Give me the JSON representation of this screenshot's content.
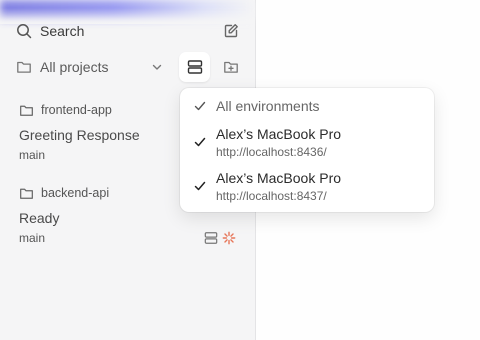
{
  "sidebar": {
    "search": {
      "label": "Search",
      "icon": "search-icon"
    },
    "new_thread_icon": "compose-icon",
    "project_filter": {
      "label": "All projects",
      "icon": "folder-icon",
      "chevron": "chevron-down-icon"
    },
    "environment_button_icon": "environments-icon",
    "new_folder_icon": "folder-plus-icon",
    "projects": [
      {
        "name": "frontend-app",
        "threads": [
          {
            "title": "Greeting Response",
            "branch": "main"
          }
        ]
      },
      {
        "name": "backend-api",
        "threads": [
          {
            "title": "Ready",
            "branch": "main",
            "status_color": "#e7775a"
          }
        ]
      }
    ]
  },
  "environment_menu": {
    "items": [
      {
        "title": "All environments",
        "subtitle": "",
        "checked": true
      },
      {
        "title": "Alex’s MacBook Pro",
        "subtitle": "http://localhost:8436/",
        "checked": true
      },
      {
        "title": "Alex’s MacBook Pro",
        "subtitle": "http://localhost:8437/",
        "checked": true
      }
    ]
  },
  "colors": {
    "accent": "#7b7ff0",
    "sidebar_bg": "#f5f5f6",
    "status_orange": "#e7775a"
  }
}
